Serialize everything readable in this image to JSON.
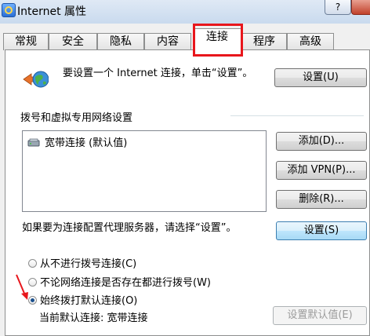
{
  "window": {
    "title": "Internet 属性",
    "help_label": "?"
  },
  "tabs": [
    "常规",
    "安全",
    "隐私",
    "内容",
    "连接",
    "程序",
    "高级"
  ],
  "active_tab": "连接",
  "setup": {
    "text": "要设置一个 Internet 连接，单击“设置”。",
    "button": "设置(U)"
  },
  "dialup_section": {
    "label": "拨号和虚拟专用网络设置",
    "items": [
      "宽带连接 (默认值)"
    ]
  },
  "buttons": {
    "add": "添加(D)...",
    "add_vpn": "添加 VPN(P)...",
    "remove": "删除(R)...",
    "settings": "设置(S)",
    "set_default": "设置默认值(E)"
  },
  "proxy_text": "如果要为连接配置代理服务器，请选择“设置”。",
  "radio_options": [
    {
      "label": "从不进行拨号连接(C)",
      "checked": false
    },
    {
      "label": "不论网络连接是否存在都进行拨号(W)",
      "checked": false
    },
    {
      "label": "始终拨打默认连接(O)",
      "checked": true
    }
  ],
  "current_default": "当前默认连接: 宽带连接",
  "colors": {
    "highlight": "#e8161c",
    "focus_border": "#3c7fb1"
  }
}
